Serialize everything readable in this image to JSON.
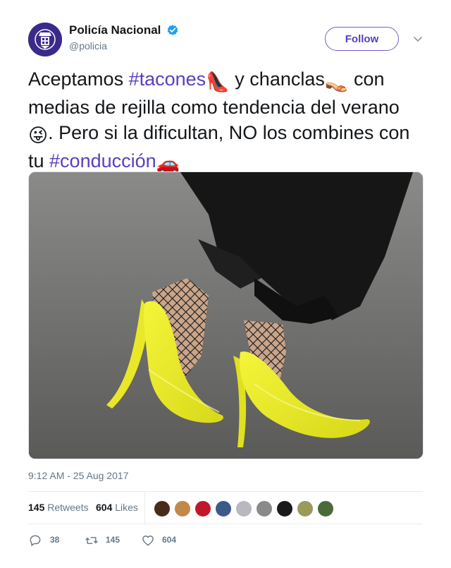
{
  "user": {
    "display_name": "Policía Nacional",
    "handle": "@policia",
    "verified": true,
    "follow_label": "Follow"
  },
  "tweet": {
    "line1_pre": "Aceptamos ",
    "hashtag1": "#tacones",
    "emoji1": "👠",
    "line1_mid": " y chanclas",
    "emoji2": "👡",
    "line1_post": " con medias de rejilla como tendencia del verano ",
    "emoji3": "😜",
    "line2": ". Pero si la dificultan, NO los combines con tu ",
    "hashtag2": "#conducción",
    "emoji4": "🚗"
  },
  "timestamp": "9:12 AM - 25 Aug 2017",
  "stats": {
    "retweets_count": "145",
    "retweets_label": "Retweets",
    "likes_count": "604",
    "likes_label": "Likes"
  },
  "actions": {
    "replies": "38",
    "retweets": "145",
    "likes": "604"
  },
  "colors": {
    "accent": "#5a3fbd",
    "verified": "#1da1f2",
    "muted": "#657786"
  },
  "icons": {
    "reply": "reply-icon",
    "retweet": "retweet-icon",
    "like": "heart-icon",
    "verified": "verified-badge-icon",
    "caret": "chevron-down-icon"
  }
}
